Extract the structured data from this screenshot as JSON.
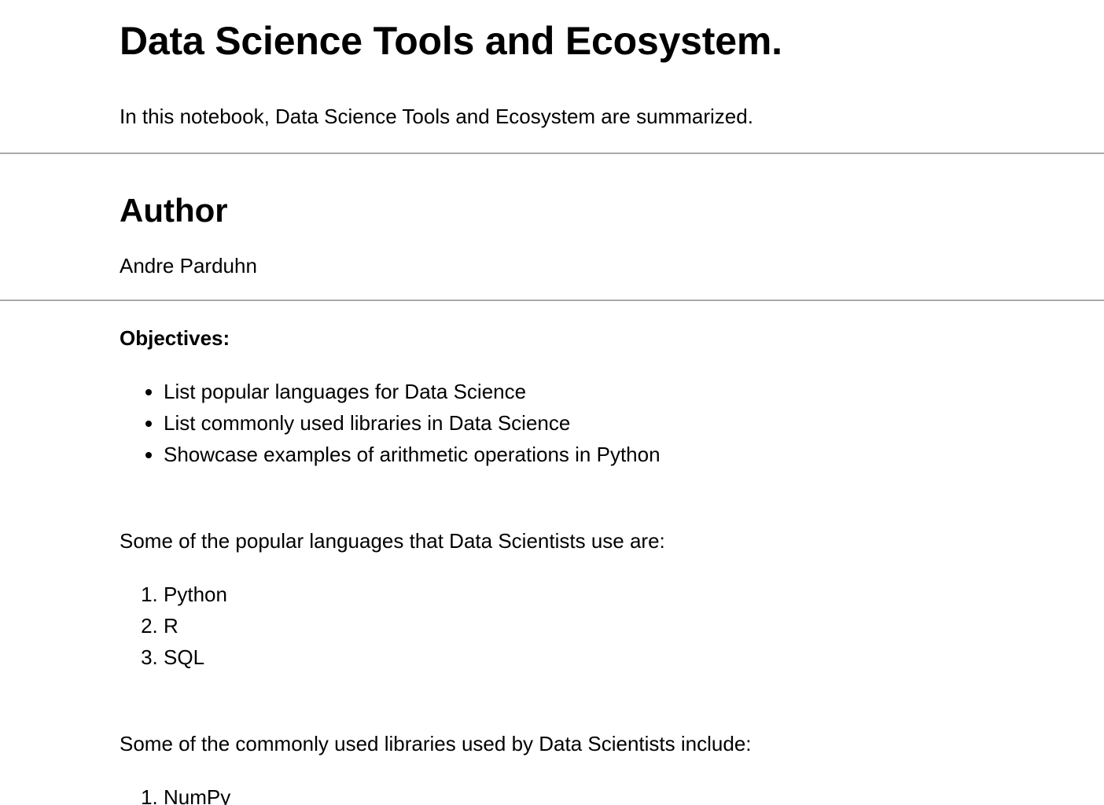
{
  "title": "Data Science Tools and Ecosystem.",
  "intro": "In this notebook, Data Science Tools and Ecosystem are summarized.",
  "author": {
    "heading": "Author",
    "name": "Andre Parduhn"
  },
  "objectives": {
    "heading": "Objectives:",
    "items": [
      "List popular languages for Data Science",
      "List commonly used libraries in Data Science",
      "Showcase examples of arithmetic operations in Python"
    ]
  },
  "languages": {
    "intro": "Some of the popular languages that Data Scientists use are:",
    "items": [
      "Python",
      "R",
      "SQL"
    ]
  },
  "libraries": {
    "intro": "Some of the commonly used libraries used by Data Scientists include:",
    "items": [
      "NumPy"
    ]
  }
}
